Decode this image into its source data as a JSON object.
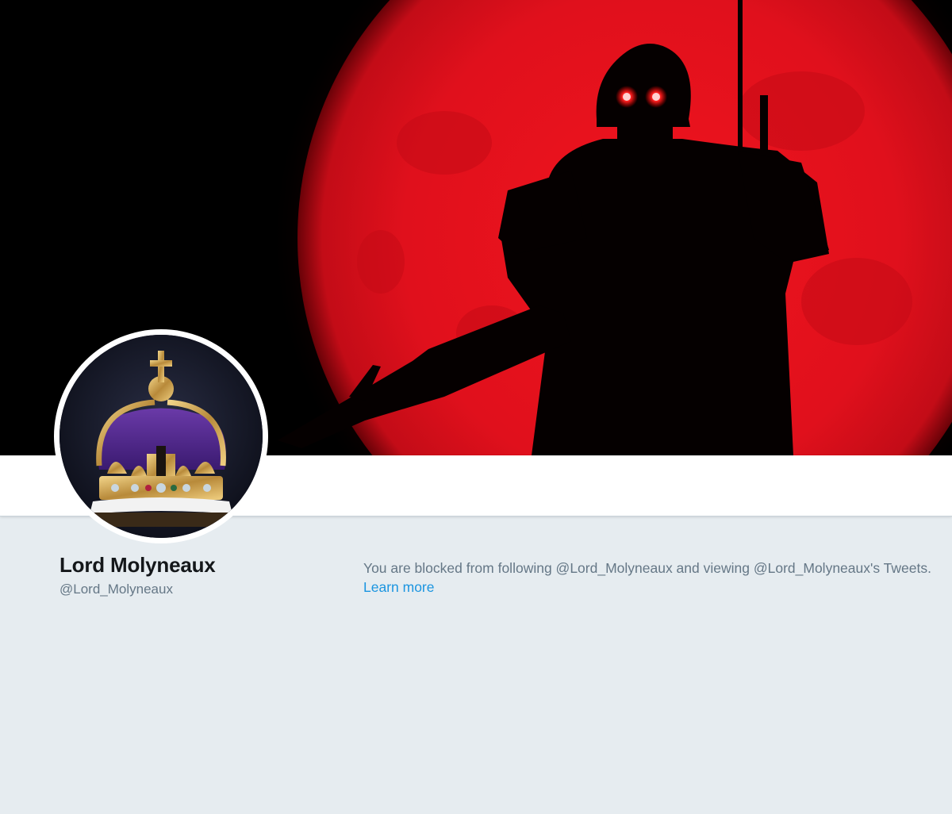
{
  "profile": {
    "display_name": "Lord Molyneaux",
    "handle": "@Lord_Molyneaux"
  },
  "blocked_notice": {
    "message": "You are blocked from following @Lord_Molyneaux and viewing @Lord_Molyneaux's Tweets.",
    "learn_more_label": "Learn more"
  },
  "colors": {
    "page_background": "#e6ecf0",
    "link": "#1b95e0",
    "secondary_text": "#657786",
    "primary_text": "#14171a",
    "banner_red": "#e0101c"
  },
  "images": {
    "banner": "red moon with silhouetted helmeted soldier holding rifle",
    "avatar": "jeweled royal crown with purple velvet cap"
  }
}
